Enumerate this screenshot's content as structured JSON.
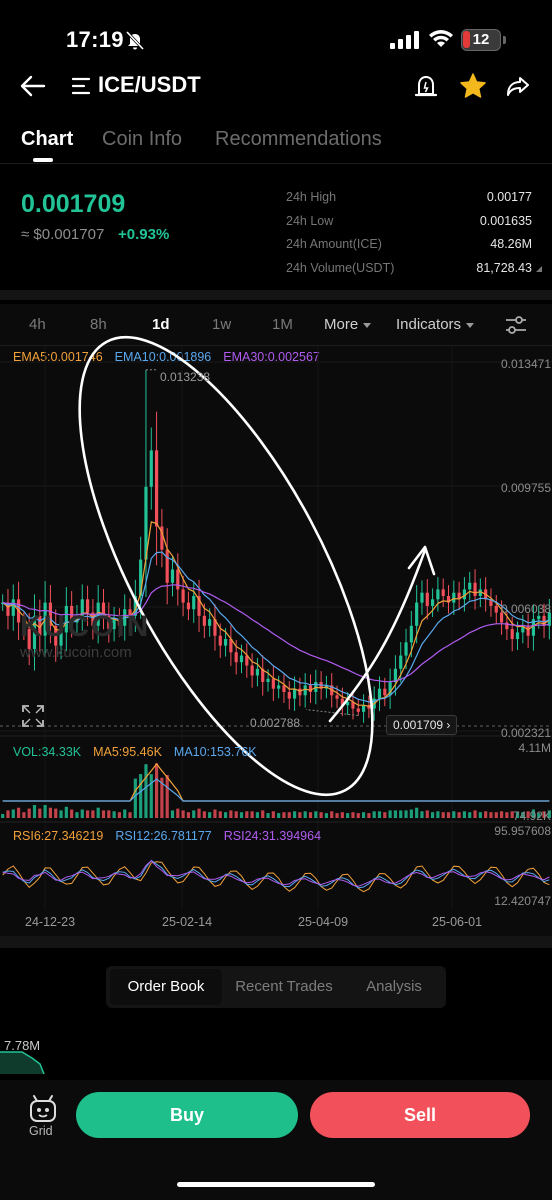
{
  "status_bar": {
    "time": "17:19",
    "battery": "12"
  },
  "header": {
    "pair": "ICE/USDT"
  },
  "tabs": [
    "Chart",
    "Coin Info",
    "Recommendations"
  ],
  "ticker": {
    "price": "0.001709",
    "fiat": "≈ $0.001707",
    "change": "+0.93%",
    "stats": [
      {
        "label": "24h High",
        "value": "0.00177"
      },
      {
        "label": "24h Low",
        "value": "0.001635"
      },
      {
        "label": "24h Amount(ICE)",
        "value": "48.26M"
      },
      {
        "label": "24h Volume(USDT)",
        "value": "81,728.43"
      }
    ]
  },
  "timeframes": [
    "4h",
    "8h",
    "1d",
    "1w",
    "1M"
  ],
  "more_label": "More",
  "indicators_label": "Indicators",
  "ema": {
    "ema5": "EMA5:0.001746",
    "ema10": "EMA10:0.001896",
    "ema30": "EMA30:0.002567"
  },
  "vol": {
    "vol": "VOL:34.33K",
    "ma5": "MA5:95.46K",
    "ma10": "MA10:153.76K"
  },
  "rsi": {
    "rsi6": "RSI6:27.346219",
    "rsi12": "RSI12:26.781177",
    "rsi24": "RSI24:31.394964"
  },
  "price_axis": [
    "0.013471",
    "0.009755",
    "0.006038",
    "0.002321"
  ],
  "vol_axis": [
    "4.11M",
    "74.92K"
  ],
  "rsi_axis": [
    "95.957608",
    "12.420747"
  ],
  "high_marker": "0.013238",
  "low_marker": "0.002788",
  "current_tag": "0.001709",
  "watermark": {
    "logo": "KUCOIN",
    "url": "www.kucoin.com"
  },
  "dates": [
    "24-12-23",
    "25-02-14",
    "25-04-09",
    "25-06-01"
  ],
  "colors": {
    "up": "#21c397",
    "down": "#f2505a",
    "ema5": "#f2a13a",
    "ema10": "#5aa8ee",
    "ema30": "#b15cf0"
  },
  "chart_data": {
    "type": "candlestick",
    "x_ticks": [
      "24-12-23",
      "25-02-14",
      "25-04-09",
      "25-06-01"
    ],
    "y_ticks": [
      "0.013471",
      "0.009755",
      "0.006038",
      "0.002321"
    ],
    "ylim": [
      0.002321,
      0.013471
    ],
    "high": 0.013238,
    "low": 0.002788,
    "last": 0.001709,
    "close_path": [
      0.0062,
      0.0058,
      0.0063,
      0.0056,
      0.0054,
      0.0048,
      0.0058,
      0.0052,
      0.0062,
      0.0055,
      0.0049,
      0.0053,
      0.0061,
      0.0056,
      0.0058,
      0.0063,
      0.0059,
      0.0055,
      0.0062,
      0.0058,
      0.0054,
      0.0057,
      0.0055,
      0.006,
      0.0058,
      0.0064,
      0.0075,
      0.0097,
      0.0108,
      0.0085,
      0.0078,
      0.0068,
      0.0072,
      0.0066,
      0.0062,
      0.006,
      0.0064,
      0.0058,
      0.0055,
      0.0057,
      0.0052,
      0.0049,
      0.0051,
      0.0047,
      0.0044,
      0.0046,
      0.0043,
      0.004,
      0.0042,
      0.0038,
      0.0039,
      0.0036,
      0.0037,
      0.0035,
      0.0033,
      0.0036,
      0.0034,
      0.0037,
      0.0035,
      0.0038,
      0.0036,
      0.0037,
      0.0034,
      0.0033,
      0.0031,
      0.0032,
      0.003,
      0.0029,
      0.0031,
      0.003,
      0.0033,
      0.0036,
      0.0034,
      0.0038,
      0.0042,
      0.0046,
      0.005,
      0.0055,
      0.0062,
      0.0065,
      0.0061,
      0.0063,
      0.0066,
      0.0064,
      0.0062,
      0.0065,
      0.0063,
      0.0066,
      0.0068,
      0.0064,
      0.0066,
      0.0063,
      0.0061,
      0.0059,
      0.0056,
      0.0054,
      0.0051,
      0.0053,
      0.0055,
      0.0052,
      0.0057,
      0.0058,
      0.0055,
      0.0059
    ]
  }
}
